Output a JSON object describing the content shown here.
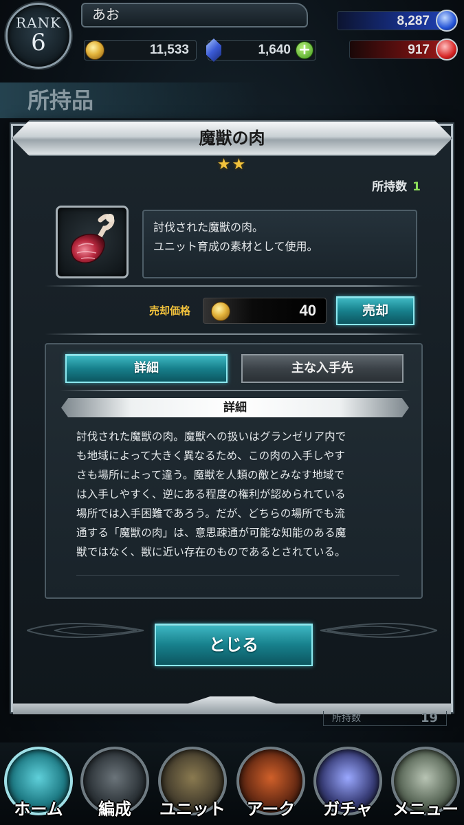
{
  "header": {
    "rank_label": "RANK",
    "rank_value": "6",
    "player_name": "あお",
    "gold": "11,533",
    "crystals": "1,640",
    "stamina_blue": "8,287",
    "stamina_red": "917"
  },
  "page_title": "所持品",
  "modal": {
    "title": "魔獣の肉",
    "rarity": "★★",
    "owned_label": "所持数",
    "owned_count": "1",
    "description_line1": "討伐された魔獣の肉。",
    "description_line2": "ユニット育成の素材として使用。",
    "sell_label": "売却価格",
    "sell_price": "40",
    "sell_button": "売却",
    "tabs": [
      {
        "label": "詳細",
        "active": true
      },
      {
        "label": "主な入手先",
        "active": false
      }
    ],
    "section_title": "詳細",
    "detail_lines": [
      "討伐された魔獣の肉。魔獣への扱いはグランゼリア内で",
      "も地域によって大きく異なるため、この肉の入手しやす",
      "さも場所によって違う。魔獣を人類の敵とみなす地域で",
      "は入手しやすく、逆にある程度の権利が認められている",
      "場所では入手困難であろう。だが、どちらの場所でも流",
      "通する「魔獣の肉」は、意思疎通が可能な知能のある魔",
      "獣ではなく、獣に近い存在のものであるとされている。"
    ],
    "close_button": "とじる"
  },
  "background": {
    "owned_label": "所持数",
    "owned_count": "19"
  },
  "nav": [
    {
      "label": "ホーム",
      "icon": "home-icon",
      "color": "#2f8f99"
    },
    {
      "label": "編成",
      "icon": "party-icon",
      "color": "#3b4248"
    },
    {
      "label": "ユニット",
      "icon": "unit-icon",
      "color": "#4a4230"
    },
    {
      "label": "アーク",
      "icon": "ark-icon",
      "color": "#6a2c14"
    },
    {
      "label": "ガチャ",
      "icon": "gacha-icon",
      "color": "#3a3f7a"
    },
    {
      "label": "メニュー",
      "icon": "menu-icon",
      "color": "#5c6a5a"
    }
  ],
  "colors": {
    "accent_teal": "#17808c",
    "rarity_gold": "#f2c23c",
    "owned_green": "#8ee05a"
  }
}
